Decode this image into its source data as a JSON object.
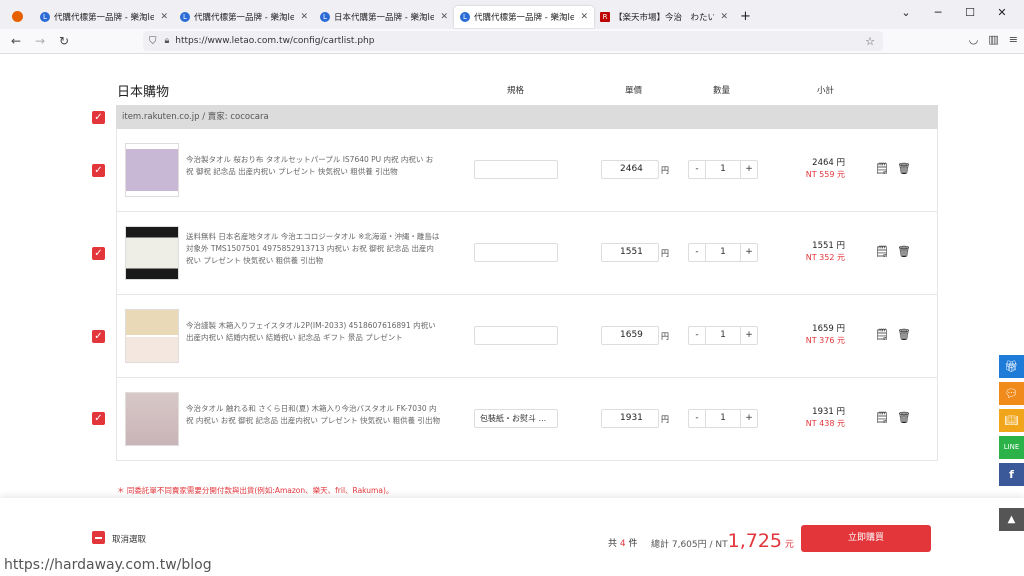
{
  "browser": {
    "tabs": [
      {
        "label": "代購代標第一品牌 - 樂淘letao",
        "active": false
      },
      {
        "label": "代購代標第一品牌 - 樂淘letao",
        "active": false
      },
      {
        "label": "日本代購第一品牌 - 樂淘letao",
        "active": false
      },
      {
        "label": "代購代標第一品牌 - 樂淘letao",
        "active": true
      },
      {
        "label": "【楽天市場】今治　わたいろ",
        "active": false
      }
    ],
    "url": "https://www.letao.com.tw/config/cartlist.php"
  },
  "cart": {
    "title": "日本購物",
    "columns": {
      "spec": "規格",
      "price": "單價",
      "qty": "數量",
      "subtotal": "小計"
    },
    "shop": "item.rakuten.co.jp / 賣家: cococara",
    "items": [
      {
        "desc": "今治製タオル 桜おり布 タオルセットパープル IS7640 PU 内祝 内祝い お祝 御祝 記念品 出産内祝い プレゼント 快気祝い 粗供養 引出物",
        "spec": "",
        "price": "2464",
        "qty": "1",
        "sub_jpy": "2464 円",
        "sub_nt": "NT 559 元"
      },
      {
        "desc": "送料無料 日本名産地タオル 今治エコロジータオル ※北海道・沖縄・離島は対象外 TMS1507501 4975852913713 内祝い お祝 御祝 記念品 出産内祝い プレゼント 快気祝い 粗供養 引出物",
        "spec": "",
        "price": "1551",
        "qty": "1",
        "sub_jpy": "1551 円",
        "sub_nt": "NT 352 元"
      },
      {
        "desc": "今治謹製 木箱入りフェイスタオル2P(IM-2033) 4518607616891 内祝い 出産内祝い 結婚内祝い 結婚祝い 記念品 ギフト 景品 プレゼント",
        "spec": "",
        "price": "1659",
        "qty": "1",
        "sub_jpy": "1659 円",
        "sub_nt": "NT 376 元"
      },
      {
        "desc": "今治タオル 触れる和 さくら日和(夏) 木箱入り今治バスタオル FK-7030 内祝 内祝い お祝 御祝 記念品 出産内祝い プレゼント 快気祝い 粗供養 引出物",
        "spec": "包裝紙・お熨斗 ...",
        "price": "1931",
        "qty": "1",
        "sub_jpy": "1931 円",
        "sub_nt": "NT 438 元"
      }
    ],
    "currency": "円",
    "minus": "-",
    "plus": "+",
    "note": "＊ 同委託單不同賣家需要分開付款與出貨(例如:Amazon、樂天、fril、Rakuma)。"
  },
  "footer": {
    "cancel_label": "取消選取",
    "count_prefix": "共",
    "count": "4",
    "count_suffix": "件",
    "total_prefix": "總計 7,605円 / NT",
    "total_nt": "1,725",
    "total_suffix": "元",
    "buy_label": "立即購買"
  },
  "watermark": "https://hardaway.com.tw/blog",
  "sidebar_colors": [
    "#1e7bd8",
    "#f08a1b",
    "#f0a51b",
    "#2bb34a",
    "#3b5998"
  ]
}
